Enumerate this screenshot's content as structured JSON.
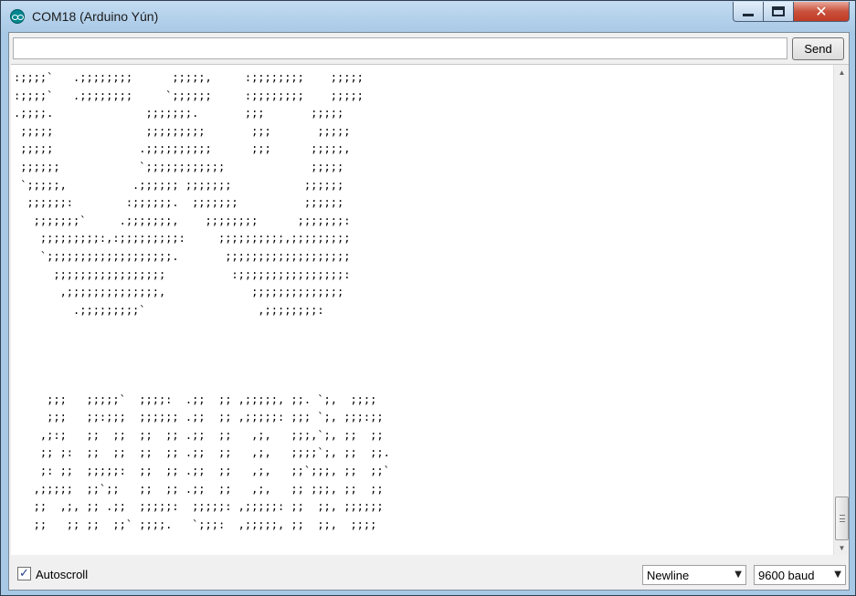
{
  "window": {
    "title": "COM18 (Arduino Yún)",
    "close_glyph": "✕"
  },
  "toolbar": {
    "input_value": "",
    "send_label": "Send"
  },
  "serial_output": {
    "lines": [
      ":;;;;`   .;;;;;;;;      ;;;;;,     :;;;;;;;;    ;;;;;",
      ":;;;;`   .;;;;;;;;     `;;;;;;     :;;;;;;;;    ;;;;;",
      ".;;;;.              ;;;;;;;.       ;;;       ;;;;;",
      " ;;;;;              ;;;;;;;;;       ;;;       ;;;;;",
      " ;;;;;             .;;;;;;;;;;      ;;;      ;;;;;,",
      " ;;;;;;            `;;;;;;;;;;;;             ;;;;;",
      " `;;;;;,          .;;;;;; ;;;;;;;           ;;;;;;",
      "  ;;;;;;:        :;;;;;;.  ;;;;;;;          ;;;;;;",
      "   ;;;;;;;`     .;;;;;;;,    ;;;;;;;;      ;;;;;;;:",
      "    ;;;;;;;;;:,:;;;;;;;;;:     ;;;;;;;;;;,;;;;;;;;;",
      "    `;;;;;;;;;;;;;;;;;;;.       ;;;;;;;;;;;;;;;;;;;",
      "      ;;;;;;;;;;;;;;;;;          :;;;;;;;;;;;;;;;;:",
      "       ,;;;;;;;;;;;;;;,             ;;;;;;;;;;;;;;",
      "         .;;;;;;;;;`                 ,;;;;;;;;:",
      "",
      "",
      "",
      "",
      "     ;;;   ;;;;;`  ;;;;:  .;;  ;; ,;;;;;, ;;. `;,  ;;;;",
      "     ;;;   ;;:;;;  ;;;;;; .;;  ;; ,;;;;;: ;;; `;, ;;;:;;",
      "    ,;:;   ;;  ;;  ;;  ;; .;;  ;;   ,;,   ;;;,`;, ;;  ;;",
      "    ;; ;:  ;;  ;;  ;;  ;; .;;  ;;   ,;,   ;;;;`;, ;;  ;;.",
      "    ;: ;;  ;;;;;:  ;;  ;; .;;  ;;   ,;,   ;;`;;;, ;;  ;;`",
      "   ,;;;;;  ;;`;;   ;;  ;; .;;  ;;   ,;,   ;; ;;;, ;;  ;;",
      "   ;;  ,;, ;; .;;  ;;;;;:  ;;;;;: ,;;;;;: ;;  ;;, ;;;;;;",
      "   ;;   ;; ;;  ;;` ;;;;.   `;;;:  ,;;;;;, ;;  ;;,  ;;;;"
    ]
  },
  "status_bar": {
    "autoscroll_checked": true,
    "autoscroll_glyph": "✓",
    "autoscroll_label": "Autoscroll",
    "line_ending_value": "Newline",
    "baud_rate_value": "9600 baud",
    "dropdown_glyph": "▼"
  },
  "scrollbar": {
    "up_glyph": "▲",
    "down_glyph": "▼"
  }
}
